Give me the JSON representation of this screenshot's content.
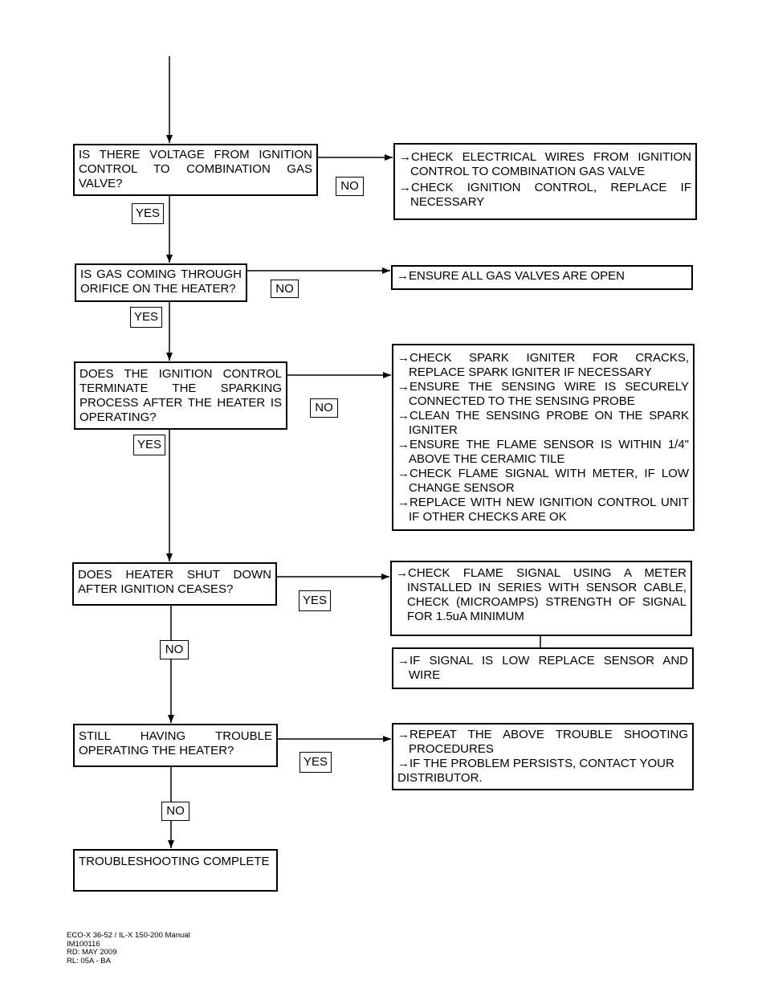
{
  "steps": [
    {
      "question": "IS THERE VOLTAGE FROM IGNITION CONTROL TO COMBINATION GAS VALVE?",
      "yes_label": "YES",
      "no_label": "NO",
      "actions": [
        "→CHECK ELECTRICAL WIRES FROM IGNITION CONTROL TO COMBINATION GAS VALVE",
        "→CHECK IGNITION CONTROL, REPLACE IF NECESSARY"
      ]
    },
    {
      "question": "IS GAS COMING THROUGH ORIFICE ON THE HEATER?",
      "yes_label": "YES",
      "no_label": "NO",
      "actions": [
        "→ENSURE ALL GAS VALVES ARE OPEN"
      ]
    },
    {
      "question": "DOES THE IGNITION CONTROL TERMINATE THE SPARKING PROCESS AFTER THE HEATER IS OPERATING?",
      "yes_label": "YES",
      "no_label": "NO",
      "actions": [
        "→CHECK SPARK IGNITER FOR CRACKS, REPLACE SPARK IGNITER IF NECESSARY",
        "→ENSURE THE SENSING WIRE IS SECURELY CONNECTED TO THE SENSING PROBE",
        "→CLEAN THE SENSING PROBE ON THE SPARK IGNITER",
        "→ENSURE THE FLAME SENSOR IS WITHIN 1/4\" ABOVE THE CERAMIC TILE",
        "→CHECK FLAME SIGNAL WITH METER, IF LOW CHANGE SENSOR",
        "→REPLACE WITH NEW IGNITION CONTROL UNIT IF OTHER CHECKS ARE OK"
      ]
    },
    {
      "question": "DOES HEATER SHUT DOWN AFTER IGNITION CEASES?",
      "yes_label": "YES",
      "no_label": "NO",
      "actions": [
        "→CHECK FLAME SIGNAL USING A METER INSTALLED IN SERIES WITH SENSOR CABLE, CHECK (MICROAMPS) STRENGTH OF SIGNAL FOR 1.5uA MINIMUM"
      ],
      "followup": "→IF SIGNAL IS LOW REPLACE SENSOR AND WIRE"
    },
    {
      "question": "STILL HAVING TROUBLE OPERATING THE HEATER?",
      "yes_label": "YES",
      "no_label": "NO",
      "actions": [
        "→REPEAT THE ABOVE TROUBLE SHOOTING PROCEDURES",
        "→IF THE PROBLEM PERSISTS, CONTACT YOUR",
        "DISTRIBUTOR."
      ]
    }
  ],
  "end": "TROUBLESHOOTING COMPLETE",
  "footer": [
    "ECO-X 36-52 / IL-X 150-200 Manual",
    "IM100116",
    "RD: MAY 2009",
    "RL: 05A - BA"
  ]
}
